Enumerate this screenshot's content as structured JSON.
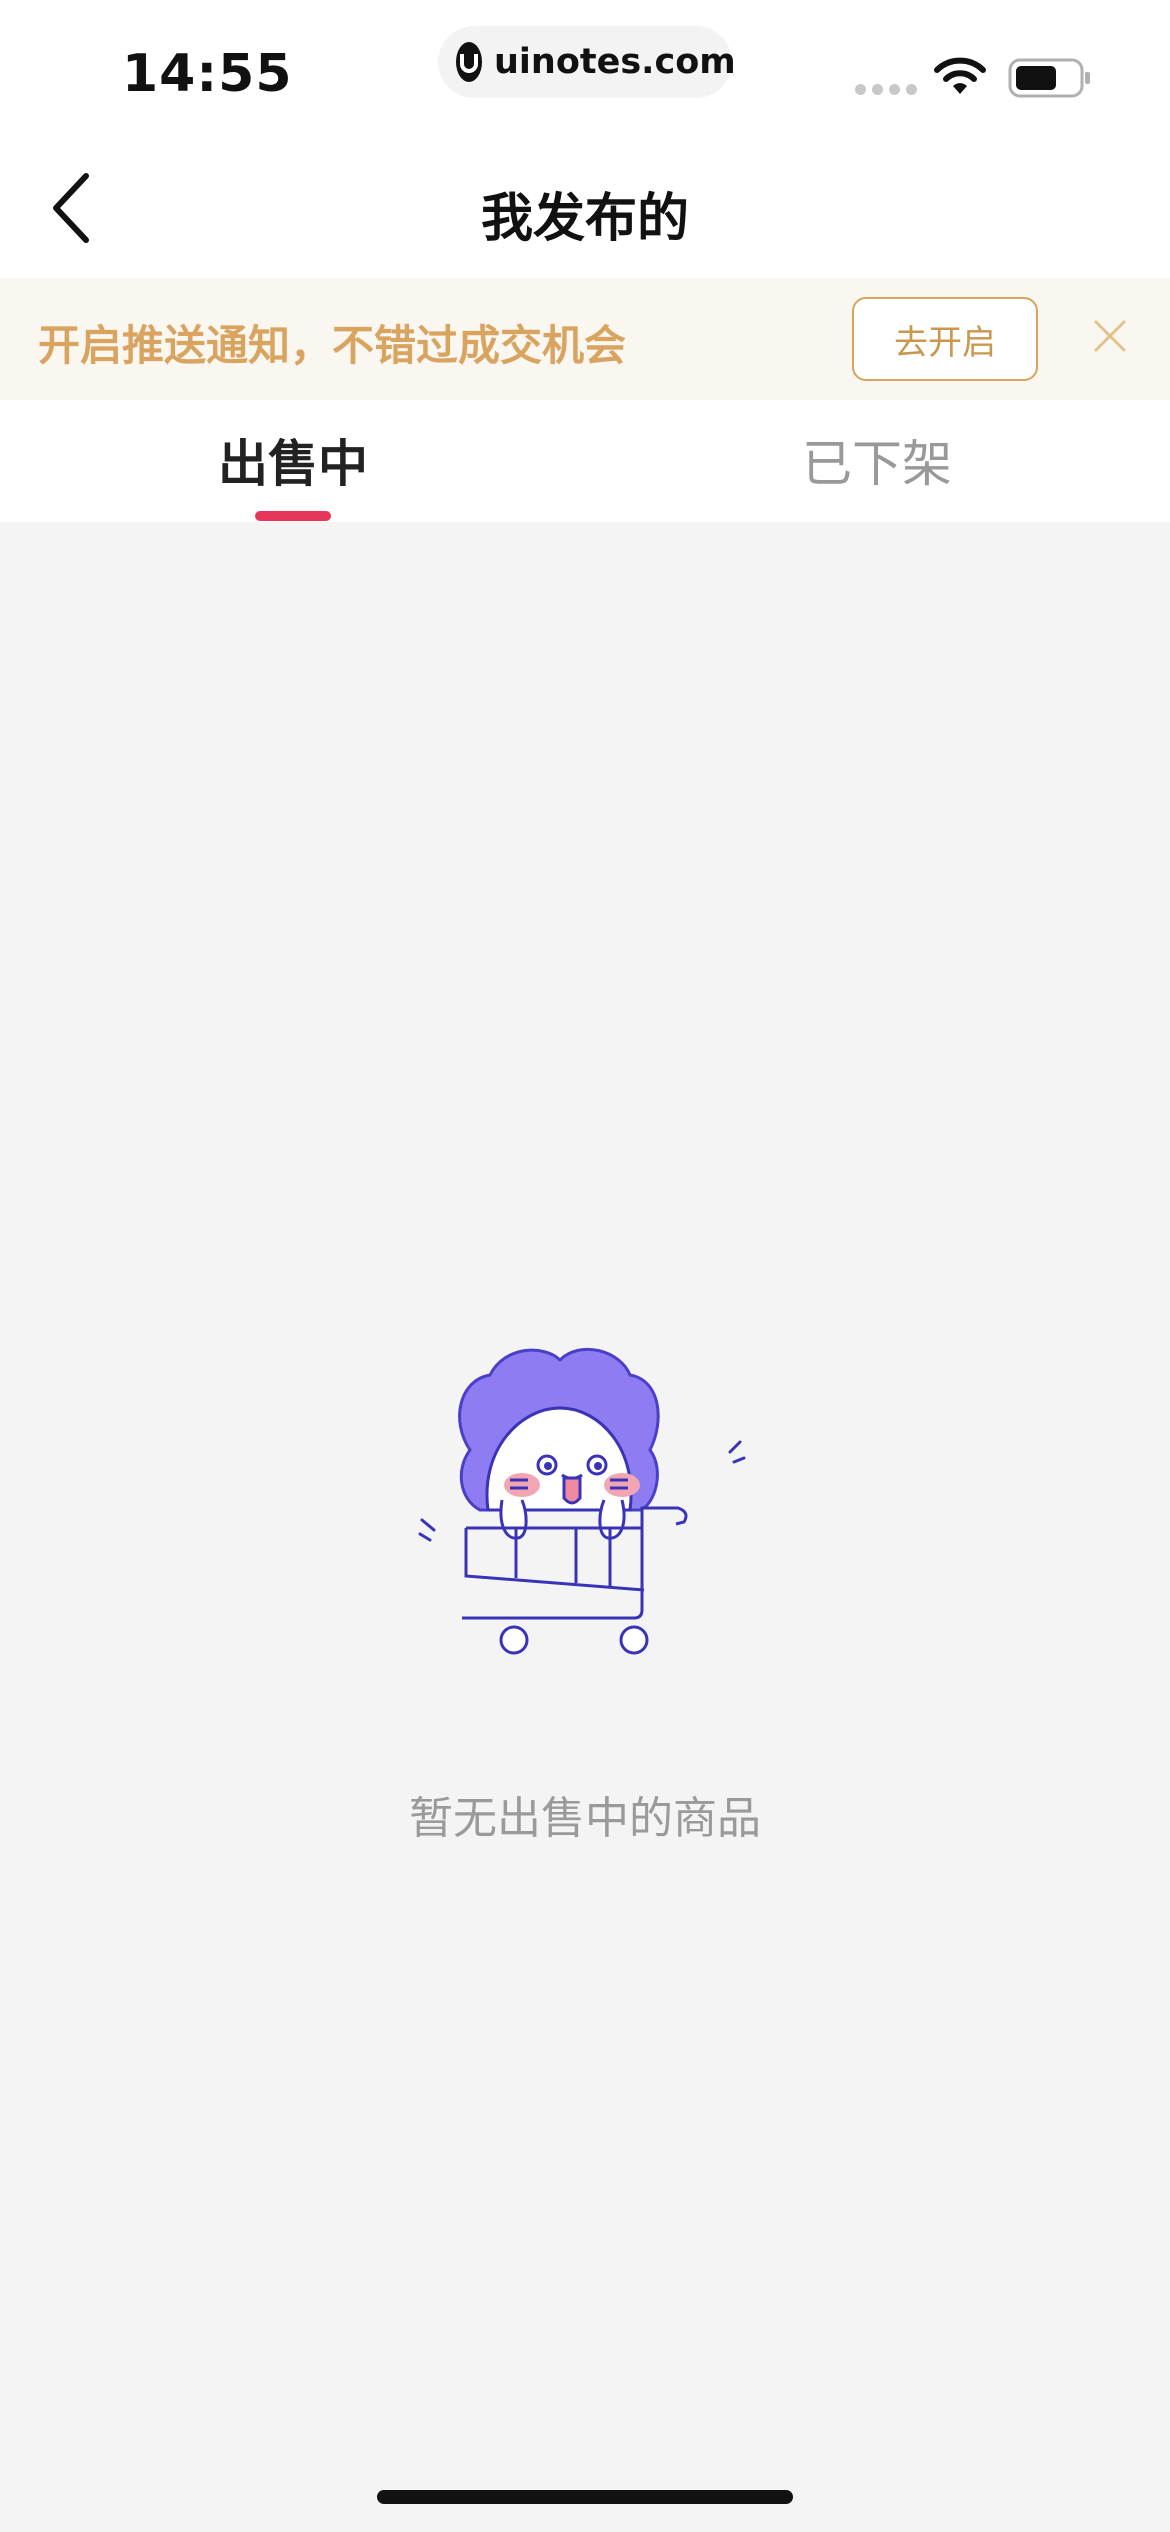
{
  "status_bar": {
    "time": "14:55",
    "url": "uinotes.com",
    "icons": [
      "cellular-signal-icon",
      "wifi-icon",
      "battery-icon"
    ]
  },
  "nav": {
    "title": "我发布的",
    "back_icon": "chevron-left-icon"
  },
  "notice": {
    "text": "开启推送通知，不错过成交机会",
    "button_label": "去开启",
    "close_icon": "close-icon",
    "text_color": "#d8a460",
    "background": "#faf6f0"
  },
  "tabs": [
    {
      "label": "出售中",
      "active": true
    },
    {
      "label": "已下架",
      "active": false
    }
  ],
  "accent_color": "#e8365a",
  "empty_state": {
    "illustration": "mascot-shopping-cart-illustration",
    "message": "暂无出售中的商品"
  }
}
